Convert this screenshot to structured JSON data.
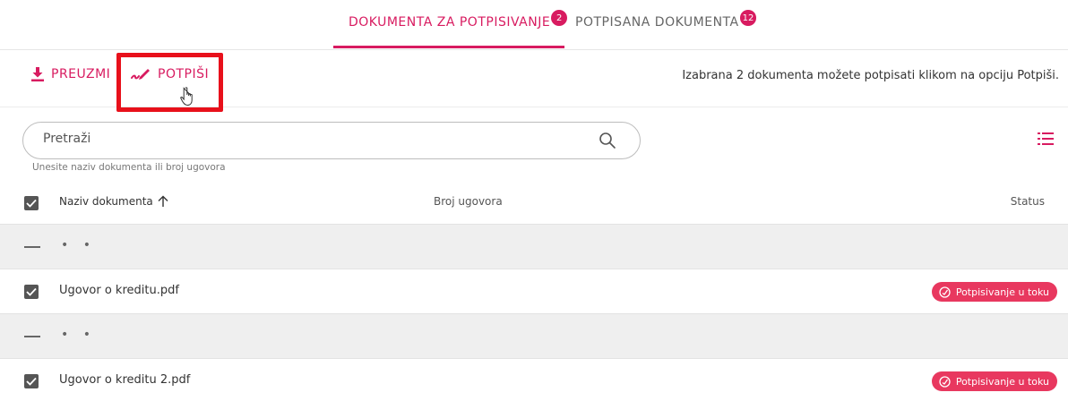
{
  "tabs": [
    {
      "label": "DOKUMENTA ZA POTPISIVANJE",
      "count": "2"
    },
    {
      "label": "POTPISANA DOKUMENTA",
      "count": "12"
    }
  ],
  "toolbar": {
    "download_label": "PREUZMI",
    "sign_label": "POTPIŠI",
    "info_text": "Izabrana 2 dokumenta možete potpisati klikom na opciju Potpiši."
  },
  "search": {
    "placeholder": "Pretraži",
    "hint": "Unesite naziv dokumenta ili broj ugovora"
  },
  "table": {
    "headers": {
      "name": "Naziv dokumenta",
      "number": "Broj ugovora",
      "status": "Status"
    },
    "groups": [
      {
        "placeholder": "• •",
        "name": "Ugovor o kreditu.pdf",
        "status": "Potpisivanje u toku"
      },
      {
        "placeholder": "• •",
        "name": "Ugovor o kreditu 2.pdf",
        "status": "Potpisivanje u toku"
      }
    ]
  },
  "colors": {
    "accent": "#d81b60",
    "highlight": "#e8101b",
    "status": "#e8385f"
  }
}
